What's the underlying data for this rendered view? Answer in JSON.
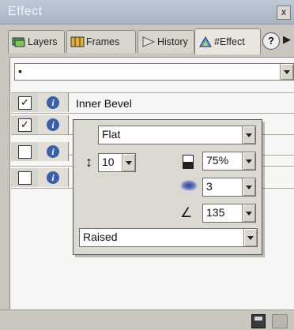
{
  "window": {
    "title": "Effect",
    "close_label": "x"
  },
  "tabs": [
    {
      "label": "Layers",
      "icon": "layers-icon"
    },
    {
      "label": "Frames",
      "icon": "frames-icon"
    },
    {
      "label": "History",
      "icon": "history-icon"
    },
    {
      "label": "#Effect",
      "icon": "effect-icon",
      "active": true
    }
  ],
  "help_label": "?",
  "tab_scroll_label": "▶",
  "effect_selector": {
    "value": "•"
  },
  "effects": [
    {
      "label": "Inner Bevel",
      "checked": true
    },
    {
      "label": "",
      "checked": true
    },
    {
      "label": "",
      "checked": false
    },
    {
      "label": "",
      "checked": false
    }
  ],
  "info_glyph": "i",
  "check_glyph": "✓",
  "bevel_editor": {
    "type": "Flat",
    "width": "10",
    "opacity": "75%",
    "softness": "3",
    "angle": "135",
    "preset": "Raised",
    "width_icon_glyph": "↕",
    "angle_icon_glyph": "∠"
  },
  "colors": {
    "active_info": "#3b5fa8",
    "title_bar": "#a9b4c4"
  }
}
